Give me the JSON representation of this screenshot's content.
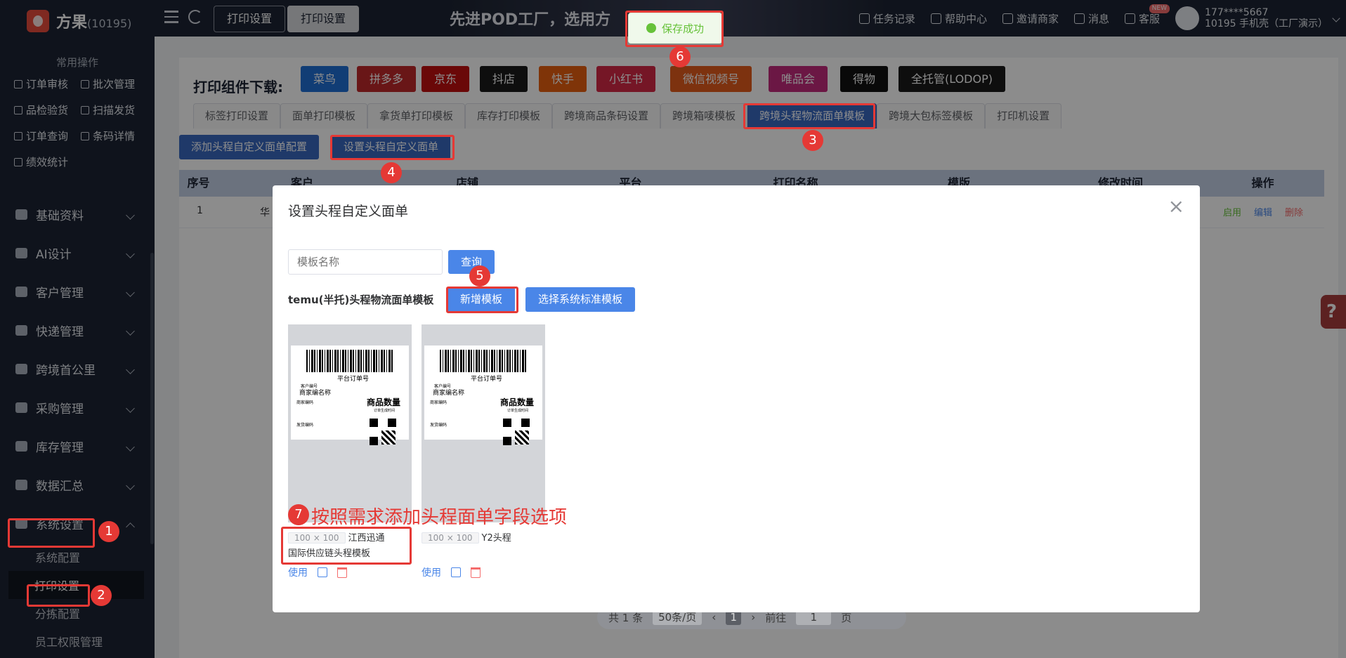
{
  "app": {
    "name": "方果",
    "tenant_id": "(10195)"
  },
  "sidebar": {
    "quick_title": "常用操作",
    "quick_items": [
      {
        "label": "订单审核",
        "icon": "check-square-icon"
      },
      {
        "label": "批次管理",
        "icon": "batch-icon"
      },
      {
        "label": "品检验货",
        "icon": "inspect-icon"
      },
      {
        "label": "扫描发货",
        "icon": "scan-icon"
      },
      {
        "label": "订单查询",
        "icon": "search-doc-icon"
      },
      {
        "label": "条码详情",
        "icon": "barcode-icon"
      },
      {
        "label": "绩效统计",
        "icon": "chart-icon"
      }
    ],
    "menu": [
      {
        "label": "基础资料",
        "icon": "database-icon"
      },
      {
        "label": "AI设计",
        "icon": "ai-icon"
      },
      {
        "label": "客户管理",
        "icon": "user-icon"
      },
      {
        "label": "快递管理",
        "icon": "truck-icon"
      },
      {
        "label": "跨境首公里",
        "icon": "globe-icon"
      },
      {
        "label": "采购管理",
        "icon": "cart-icon"
      },
      {
        "label": "库存管理",
        "icon": "warehouse-icon"
      },
      {
        "label": "数据汇总",
        "icon": "pie-icon"
      },
      {
        "label": "系统设置",
        "icon": "settings-icon"
      }
    ],
    "submenu": [
      "系统配置",
      "打印设置",
      "分拣配置",
      "员工权限管理"
    ]
  },
  "header": {
    "tabs": [
      "打印设置",
      "打印设置"
    ],
    "banner": "先进POD工厂，选用方",
    "right_items": [
      {
        "label": "任务记录",
        "icon": "task-icon"
      },
      {
        "label": "帮助中心",
        "icon": "help-icon"
      },
      {
        "label": "邀请商家",
        "icon": "invite-icon"
      },
      {
        "label": "消息",
        "icon": "message-icon"
      },
      {
        "label": "客服",
        "icon": "headset-icon"
      }
    ],
    "new_badge": "NEW",
    "user_line1": "177****5667",
    "user_line2": "10195 手机壳（工厂演示）"
  },
  "page": {
    "download_label": "打印组件下载:",
    "download_buttons": [
      {
        "label": "菜鸟",
        "color": "#1f6fd6"
      },
      {
        "label": "拼多多",
        "color": "#c0292b"
      },
      {
        "label": "京东",
        "color": "#c21010"
      },
      {
        "label": "抖店",
        "color": "#1a1a1a"
      },
      {
        "label": "快手",
        "color": "#e8600f"
      },
      {
        "label": "小红书",
        "color": "#d62845"
      },
      {
        "label": "微信视频号",
        "color": "#e45b1c"
      },
      {
        "label": "唯品会",
        "color": "#c42a7c"
      },
      {
        "label": "得物",
        "color": "#111111"
      },
      {
        "label": "全托管(LODOP)",
        "color": "#1a1a1a"
      }
    ],
    "tabs": [
      "标签打印设置",
      "面单打印模板",
      "拿货单打印模板",
      "库存打印模板",
      "跨境商品条码设置",
      "跨境箱唛模板",
      "跨境头程物流面单模板",
      "跨境大包标签模板",
      "打印机设置"
    ],
    "active_tab": 6,
    "action_buttons": [
      "添加头程自定义面单配置",
      "设置头程自定义面单"
    ],
    "table_headers": [
      "序号",
      "客户",
      "店铺",
      "平台",
      "打印名称",
      "模版",
      "修改时间",
      "操作"
    ],
    "row": {
      "no": "1",
      "customer": "华",
      "ops": [
        "启用",
        "编辑",
        "删除"
      ]
    },
    "pager": {
      "total": "共 1 条",
      "page_size": "50条/页",
      "prev": "‹",
      "current": "1",
      "next": "›",
      "goto": "前往",
      "goto_value": "1",
      "page_unit": "页"
    }
  },
  "dialog": {
    "title": "设置头程自定义面单",
    "search_placeholder": "模板名称",
    "search_button": "查询",
    "template_section": "temu(半托)头程物流面单模板",
    "add_button": "新增模板",
    "system_button": "选择系统标准模板",
    "label_preview": {
      "order_no": "平台订单号",
      "customer_no": "客户编号",
      "merchant": "商家编名称",
      "qty": "商品数量",
      "small1": "商家编码",
      "small2": "订单生成时间",
      "small3": "发货编码"
    },
    "templates": [
      {
        "size": "100 × 100",
        "name": "江西迅通国际供应链头程模板",
        "use": "使用"
      },
      {
        "size": "100 × 100",
        "name": "Y2头程",
        "use": "使用"
      }
    ]
  },
  "toast": {
    "message": "保存成功"
  },
  "annotations": {
    "steps": [
      "1",
      "2",
      "3",
      "4",
      "5",
      "6",
      "7"
    ],
    "note": "按照需求添加头程面单字段选项",
    "color": "#e53935"
  }
}
